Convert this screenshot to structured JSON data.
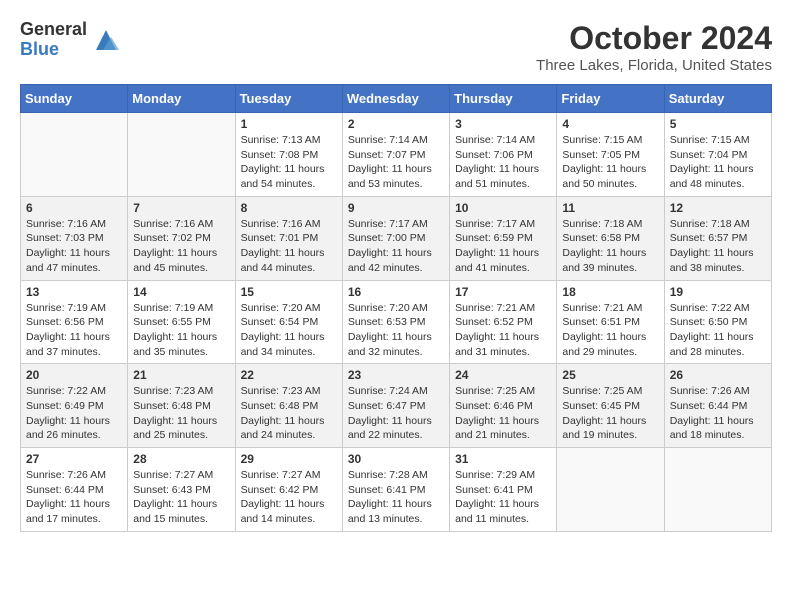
{
  "header": {
    "logo_general": "General",
    "logo_blue": "Blue",
    "month_title": "October 2024",
    "location": "Three Lakes, Florida, United States"
  },
  "weekdays": [
    "Sunday",
    "Monday",
    "Tuesday",
    "Wednesday",
    "Thursday",
    "Friday",
    "Saturday"
  ],
  "weeks": [
    [
      {
        "day": "",
        "info": ""
      },
      {
        "day": "",
        "info": ""
      },
      {
        "day": "1",
        "info": "Sunrise: 7:13 AM\nSunset: 7:08 PM\nDaylight: 11 hours and 54 minutes."
      },
      {
        "day": "2",
        "info": "Sunrise: 7:14 AM\nSunset: 7:07 PM\nDaylight: 11 hours and 53 minutes."
      },
      {
        "day": "3",
        "info": "Sunrise: 7:14 AM\nSunset: 7:06 PM\nDaylight: 11 hours and 51 minutes."
      },
      {
        "day": "4",
        "info": "Sunrise: 7:15 AM\nSunset: 7:05 PM\nDaylight: 11 hours and 50 minutes."
      },
      {
        "day": "5",
        "info": "Sunrise: 7:15 AM\nSunset: 7:04 PM\nDaylight: 11 hours and 48 minutes."
      }
    ],
    [
      {
        "day": "6",
        "info": "Sunrise: 7:16 AM\nSunset: 7:03 PM\nDaylight: 11 hours and 47 minutes."
      },
      {
        "day": "7",
        "info": "Sunrise: 7:16 AM\nSunset: 7:02 PM\nDaylight: 11 hours and 45 minutes."
      },
      {
        "day": "8",
        "info": "Sunrise: 7:16 AM\nSunset: 7:01 PM\nDaylight: 11 hours and 44 minutes."
      },
      {
        "day": "9",
        "info": "Sunrise: 7:17 AM\nSunset: 7:00 PM\nDaylight: 11 hours and 42 minutes."
      },
      {
        "day": "10",
        "info": "Sunrise: 7:17 AM\nSunset: 6:59 PM\nDaylight: 11 hours and 41 minutes."
      },
      {
        "day": "11",
        "info": "Sunrise: 7:18 AM\nSunset: 6:58 PM\nDaylight: 11 hours and 39 minutes."
      },
      {
        "day": "12",
        "info": "Sunrise: 7:18 AM\nSunset: 6:57 PM\nDaylight: 11 hours and 38 minutes."
      }
    ],
    [
      {
        "day": "13",
        "info": "Sunrise: 7:19 AM\nSunset: 6:56 PM\nDaylight: 11 hours and 37 minutes."
      },
      {
        "day": "14",
        "info": "Sunrise: 7:19 AM\nSunset: 6:55 PM\nDaylight: 11 hours and 35 minutes."
      },
      {
        "day": "15",
        "info": "Sunrise: 7:20 AM\nSunset: 6:54 PM\nDaylight: 11 hours and 34 minutes."
      },
      {
        "day": "16",
        "info": "Sunrise: 7:20 AM\nSunset: 6:53 PM\nDaylight: 11 hours and 32 minutes."
      },
      {
        "day": "17",
        "info": "Sunrise: 7:21 AM\nSunset: 6:52 PM\nDaylight: 11 hours and 31 minutes."
      },
      {
        "day": "18",
        "info": "Sunrise: 7:21 AM\nSunset: 6:51 PM\nDaylight: 11 hours and 29 minutes."
      },
      {
        "day": "19",
        "info": "Sunrise: 7:22 AM\nSunset: 6:50 PM\nDaylight: 11 hours and 28 minutes."
      }
    ],
    [
      {
        "day": "20",
        "info": "Sunrise: 7:22 AM\nSunset: 6:49 PM\nDaylight: 11 hours and 26 minutes."
      },
      {
        "day": "21",
        "info": "Sunrise: 7:23 AM\nSunset: 6:48 PM\nDaylight: 11 hours and 25 minutes."
      },
      {
        "day": "22",
        "info": "Sunrise: 7:23 AM\nSunset: 6:48 PM\nDaylight: 11 hours and 24 minutes."
      },
      {
        "day": "23",
        "info": "Sunrise: 7:24 AM\nSunset: 6:47 PM\nDaylight: 11 hours and 22 minutes."
      },
      {
        "day": "24",
        "info": "Sunrise: 7:25 AM\nSunset: 6:46 PM\nDaylight: 11 hours and 21 minutes."
      },
      {
        "day": "25",
        "info": "Sunrise: 7:25 AM\nSunset: 6:45 PM\nDaylight: 11 hours and 19 minutes."
      },
      {
        "day": "26",
        "info": "Sunrise: 7:26 AM\nSunset: 6:44 PM\nDaylight: 11 hours and 18 minutes."
      }
    ],
    [
      {
        "day": "27",
        "info": "Sunrise: 7:26 AM\nSunset: 6:44 PM\nDaylight: 11 hours and 17 minutes."
      },
      {
        "day": "28",
        "info": "Sunrise: 7:27 AM\nSunset: 6:43 PM\nDaylight: 11 hours and 15 minutes."
      },
      {
        "day": "29",
        "info": "Sunrise: 7:27 AM\nSunset: 6:42 PM\nDaylight: 11 hours and 14 minutes."
      },
      {
        "day": "30",
        "info": "Sunrise: 7:28 AM\nSunset: 6:41 PM\nDaylight: 11 hours and 13 minutes."
      },
      {
        "day": "31",
        "info": "Sunrise: 7:29 AM\nSunset: 6:41 PM\nDaylight: 11 hours and 11 minutes."
      },
      {
        "day": "",
        "info": ""
      },
      {
        "day": "",
        "info": ""
      }
    ]
  ]
}
